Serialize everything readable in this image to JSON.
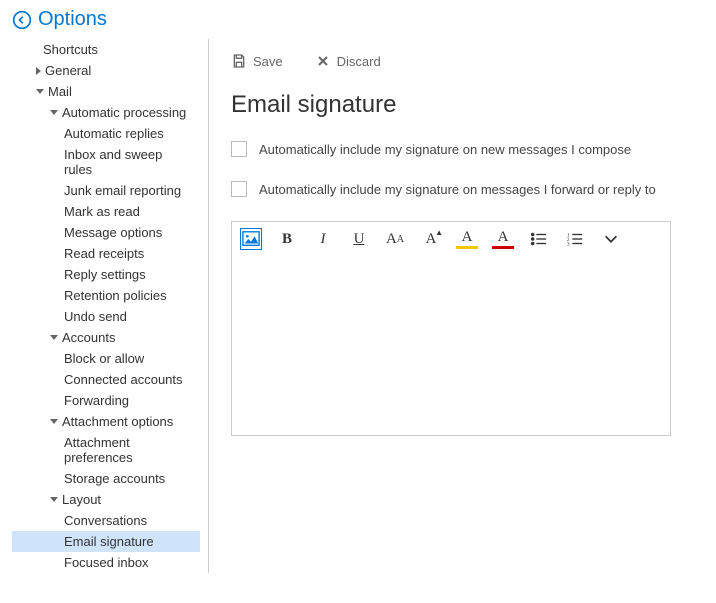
{
  "header": {
    "title": "Options"
  },
  "sidebar": {
    "shortcuts": "Shortcuts",
    "general": "General",
    "mail": "Mail",
    "auto_processing": "Automatic processing",
    "auto_items": [
      "Automatic replies",
      "Inbox and sweep rules",
      "Junk email reporting",
      "Mark as read",
      "Message options",
      "Read receipts",
      "Reply settings",
      "Retention policies",
      "Undo send"
    ],
    "accounts": "Accounts",
    "accounts_items": [
      "Block or allow",
      "Connected accounts",
      "Forwarding"
    ],
    "attachment": "Attachment options",
    "attachment_items": [
      "Attachment preferences",
      "Storage accounts"
    ],
    "layout": "Layout",
    "layout_items": [
      "Conversations",
      "Email signature",
      "Focused inbox"
    ]
  },
  "actions": {
    "save": "Save",
    "discard": "Discard"
  },
  "main": {
    "title": "Email signature",
    "chk1": "Automatically include my signature on new messages I compose",
    "chk2": "Automatically include my signature on messages I forward or reply to"
  },
  "toolbar": {
    "bold": "B",
    "italic": "I",
    "underline": "U",
    "font_size": "AA",
    "grow": "A",
    "highlight": "A",
    "color": "A"
  }
}
